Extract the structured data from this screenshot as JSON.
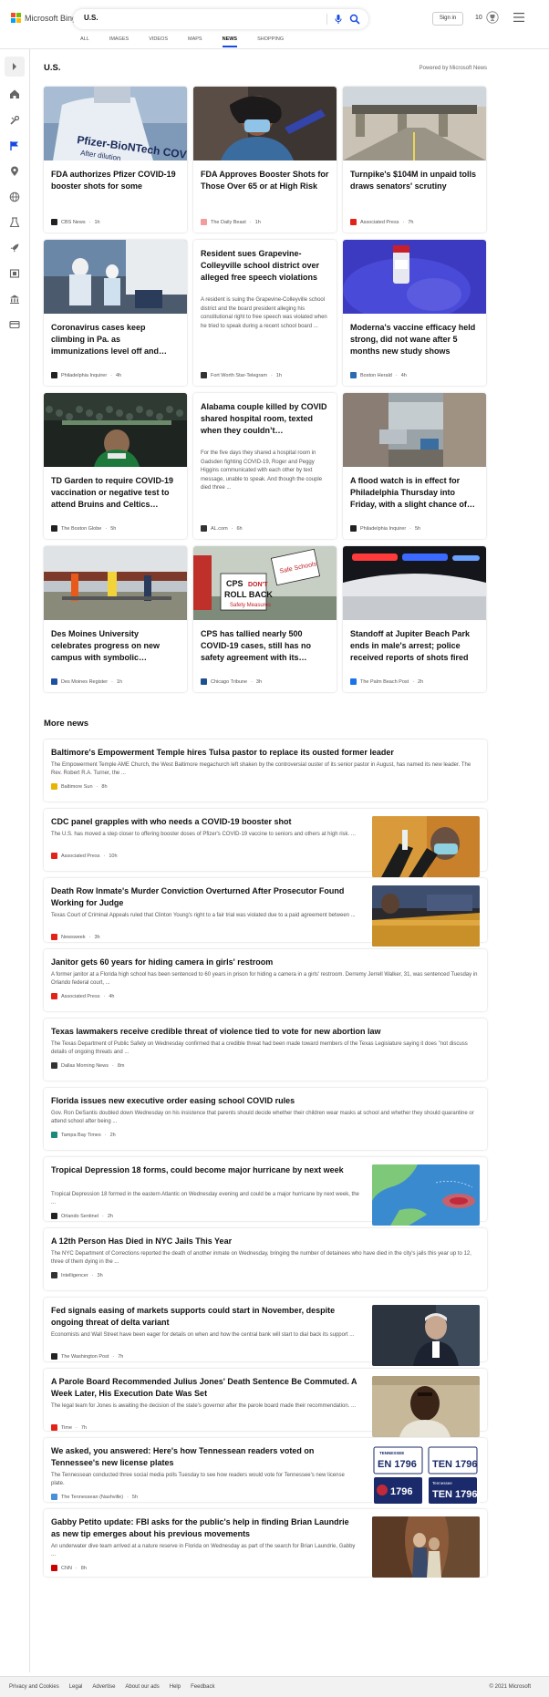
{
  "brand": {
    "name": "Microsoft Bing",
    "colors": [
      "#f25022",
      "#7fba00",
      "#00a4ef",
      "#ffb900"
    ]
  },
  "search": {
    "value": "U.S.",
    "mic_icon": "mic-icon",
    "search_icon": "search-icon"
  },
  "header": {
    "signin_label": "Sign in",
    "rewards_count": "10",
    "rewards_icon": "trophy-icon",
    "menu_icon": "hamburger-icon"
  },
  "tabs": [
    {
      "label": "ALL",
      "active": false
    },
    {
      "label": "IMAGES",
      "active": false
    },
    {
      "label": "VIDEOS",
      "active": false
    },
    {
      "label": "MAPS",
      "active": false
    },
    {
      "label": "NEWS",
      "active": true
    },
    {
      "label": "SHOPPING",
      "active": false
    }
  ],
  "sidebar": {
    "icons": [
      "chevron-right-icon",
      "home-icon",
      "tools-icon",
      "flag-icon",
      "location-icon",
      "globe-icon",
      "science-icon",
      "rocket-icon",
      "film-icon",
      "bank-icon",
      "card-icon"
    ]
  },
  "section": {
    "title": "U.S.",
    "powered_by": "Powered by Microsoft News"
  },
  "top_stories": [
    {
      "title": "FDA authorizes Pfizer COVID-19 booster shots for some",
      "snippet": "",
      "source": "CBS News",
      "time": "1h",
      "src_color": "#222222",
      "img": "vial"
    },
    {
      "title": "FDA Approves Booster Shots for Those Over 65 or at High Risk",
      "snippet": "",
      "source": "The Daily Beast",
      "time": "1h",
      "src_color": "#f29d9d",
      "img": "nurse"
    },
    {
      "title": "Turnpike's $104M in unpaid tolls draws senators' scrutiny",
      "snippet": "",
      "source": "Associated Press",
      "time": "7h",
      "src_color": "#e2231a",
      "img": "tolls"
    },
    {
      "title": "Coronavirus cases keep climbing in Pa. as immunizations level off and…",
      "snippet": "",
      "source": "Philadelphia Inquirer",
      "time": "4h",
      "src_color": "#222222",
      "img": "testing"
    },
    {
      "title": "Resident sues Grapevine-Colleyville school district over alleged free speech violations",
      "snippet": "A resident is suing the Grapevine-Colleyville school district and the board president alleging his constitutional right to free speech was violated when he tried to speak during a recent school board ...",
      "source": "Fort Worth Star-Telegram",
      "time": "1h",
      "src_color": "#333333",
      "img": ""
    },
    {
      "title": "Moderna's vaccine efficacy held strong, did not wane after 5 months new study shows",
      "snippet": "",
      "source": "Boston Herald",
      "time": "4h",
      "src_color": "#2b6cb0",
      "img": "gloves"
    },
    {
      "title": "TD Garden to require COVID-19 vaccination or negative test to attend Bruins and Celtics…",
      "snippet": "",
      "source": "The Boston Globe",
      "time": "5h",
      "src_color": "#222222",
      "img": "crowd"
    },
    {
      "title": "Alabama couple killed by COVID shared hospital room, texted when they couldn’t…",
      "snippet": "For the five days they shared a hospital room in Gadsden fighting COVID-19, Roger and Peggy Higgins communicated with each other by text message, unable to speak. And though the couple died three ...",
      "source": "AL.com",
      "time": "6h",
      "src_color": "#333333",
      "img": ""
    },
    {
      "title": "A flood watch is in effect for Philadelphia Thursday into Friday, with a slight chance of…",
      "snippet": "",
      "source": "Philadelphia Inquirer",
      "time": "5h",
      "src_color": "#222222",
      "img": "flood"
    },
    {
      "title": "Des Moines University celebrates progress on new campus with symbolic…",
      "snippet": "",
      "source": "Des Moines Register",
      "time": "1h",
      "src_color": "#1f4fa3",
      "img": "campus"
    },
    {
      "title": "CPS has tallied nearly 500 COVID-19 cases, still has no safety agreement with its…",
      "snippet": "",
      "source": "Chicago Tribune",
      "time": "3h",
      "src_color": "#1d4f91",
      "img": "protest"
    },
    {
      "title": "Standoff at Jupiter Beach Park ends in male's arrest; police received reports of shots fired",
      "snippet": "",
      "source": "The Palm Beach Post",
      "time": "2h",
      "src_color": "#1a73e8",
      "img": "police"
    }
  ],
  "protest_signs": {
    "sign1": "CPS DON'T ROLL BACK Safety Measures",
    "sign2": "Safe Schools"
  },
  "vial_text": "Pfizer-BioNTech COV After dilution",
  "more_news": {
    "title": "More news",
    "items": [
      {
        "title": "Baltimore's Empowerment Temple hires Tulsa pastor to replace its ousted former leader",
        "snippet": "The Empowerment Temple AME Church, the West Baltimore megachurch left shaken by the controversial ouster of its senior pastor in August, has named its new leader. The Rev. Robert R.A. Turner, the ...",
        "source": "Baltimore Sun",
        "time": "8h",
        "src_color": "#e8b400",
        "thumb": ""
      },
      {
        "title": "CDC panel grapples with who needs a COVID-19 booster shot",
        "snippet": "The U.S. has moved a step closer to offering booster doses of Pfizer's COVID-19 vaccine to seniors and others at high risk. ...",
        "source": "Associated Press",
        "time": "10h",
        "src_color": "#e2231a",
        "thumb": "cdc"
      },
      {
        "title": "Death Row Inmate's Murder Conviction Overturned After Prosecutor Found Working for Judge",
        "snippet": "Texas Court of Criminal Appeals ruled that Clinton Young's right to a fair trial was violated due to a paid agreement between ...",
        "source": "Newsweek",
        "time": "3h",
        "src_color": "#e2231a",
        "thumb": "court"
      },
      {
        "title": "Janitor gets 60 years for hiding camera in girls' restroom",
        "snippet": "A former janitor at a Florida high school has been sentenced to 60 years in prison for hiding a camera in a girls' restroom. Derremy Jerrell Walker, 31, was sentenced Tuesday in Orlando federal court, ...",
        "source": "Associated Press",
        "time": "4h",
        "src_color": "#e2231a",
        "thumb": ""
      },
      {
        "title": "Texas lawmakers receive credible threat of violence tied to vote for new abortion law",
        "snippet": "The Texas Department of Public Safety on Wednesday confirmed that a credible threat had been made toward members of the Texas Legislature saying it does \"not discuss details of ongoing threats and ...",
        "source": "Dallas Morning News",
        "time": "8m",
        "src_color": "#333333",
        "thumb": ""
      },
      {
        "title": "Florida issues new executive order easing school COVID rules",
        "snippet": "Gov. Ron DeSantis doubled down Wednesday on his insistence that parents should decide whether their children wear masks at school and whether they should quarantine or attend school after being ...",
        "source": "Tampa Bay Times",
        "time": "2h",
        "src_color": "#1a8a7a",
        "thumb": ""
      },
      {
        "title": "Tropical Depression 18 forms, could become major hurricane by next week",
        "snippet": "Tropical Depression 18 formed in the eastern Atlantic on Wednesday evening and could be a major hurricane by next week, the ...",
        "source": "Orlando Sentinel",
        "time": "2h",
        "src_color": "#222222",
        "thumb": "map"
      },
      {
        "title": "A 12th Person Has Died in NYC Jails This Year",
        "snippet": "The NYC Department of Corrections reported the death of another inmate on Wednesday, bringing the number of detainees who have died in the city's jails this year up to 12, three of them dying in the ...",
        "source": "Intelligencer",
        "time": "3h",
        "src_color": "#333333",
        "thumb": ""
      },
      {
        "title": "Fed signals easing of markets supports could start in November, despite ongoing threat of delta variant",
        "snippet": "Economists and Wall Street have been eager for details on when and how the central bank will start to dial back its support ...",
        "source": "The Washington Post",
        "time": "7h",
        "src_color": "#222222",
        "thumb": "fed"
      },
      {
        "title": "A Parole Board Recommended Julius Jones' Death Sentence Be Commuted. A Week Later, His Execution Date Was Set",
        "snippet": "The legal team for Jones is awaiting the decision of the state's governor after the parole board made their recommendation. ...",
        "source": "Time",
        "time": "7h",
        "src_color": "#e2231a",
        "thumb": "portrait"
      },
      {
        "title": "We asked, you answered: Here's how Tennessean readers voted on Tennessee's new license plates",
        "snippet": "The Tennessean conducted three social media polls Tuesday to see how readers would vote for Tennessee's new license plate.",
        "source": "The Tennessean (Nashville)",
        "time": "5h",
        "src_color": "#4a90d9",
        "thumb": "plates"
      },
      {
        "title": "Gabby Petito update: FBI asks for the public's help in finding Brian Laundrie as new tip emerges about his previous movements",
        "snippet": "An underwater dive team arrived at a nature reserve in Florida on Wednesday as part of the search for Brian Laundrie, Gabby ...",
        "source": "CNN",
        "time": "8h",
        "src_color": "#cc0000",
        "thumb": "canyon"
      }
    ]
  },
  "plate_text": {
    "state": "TENNESSEE",
    "number": "EN 1796",
    "number2": "TEN 1796"
  },
  "footer": {
    "links": [
      "Privacy and Cookies",
      "Legal",
      "Advertise",
      "About our ads",
      "Help",
      "Feedback"
    ],
    "copyright": "© 2021 Microsoft"
  }
}
